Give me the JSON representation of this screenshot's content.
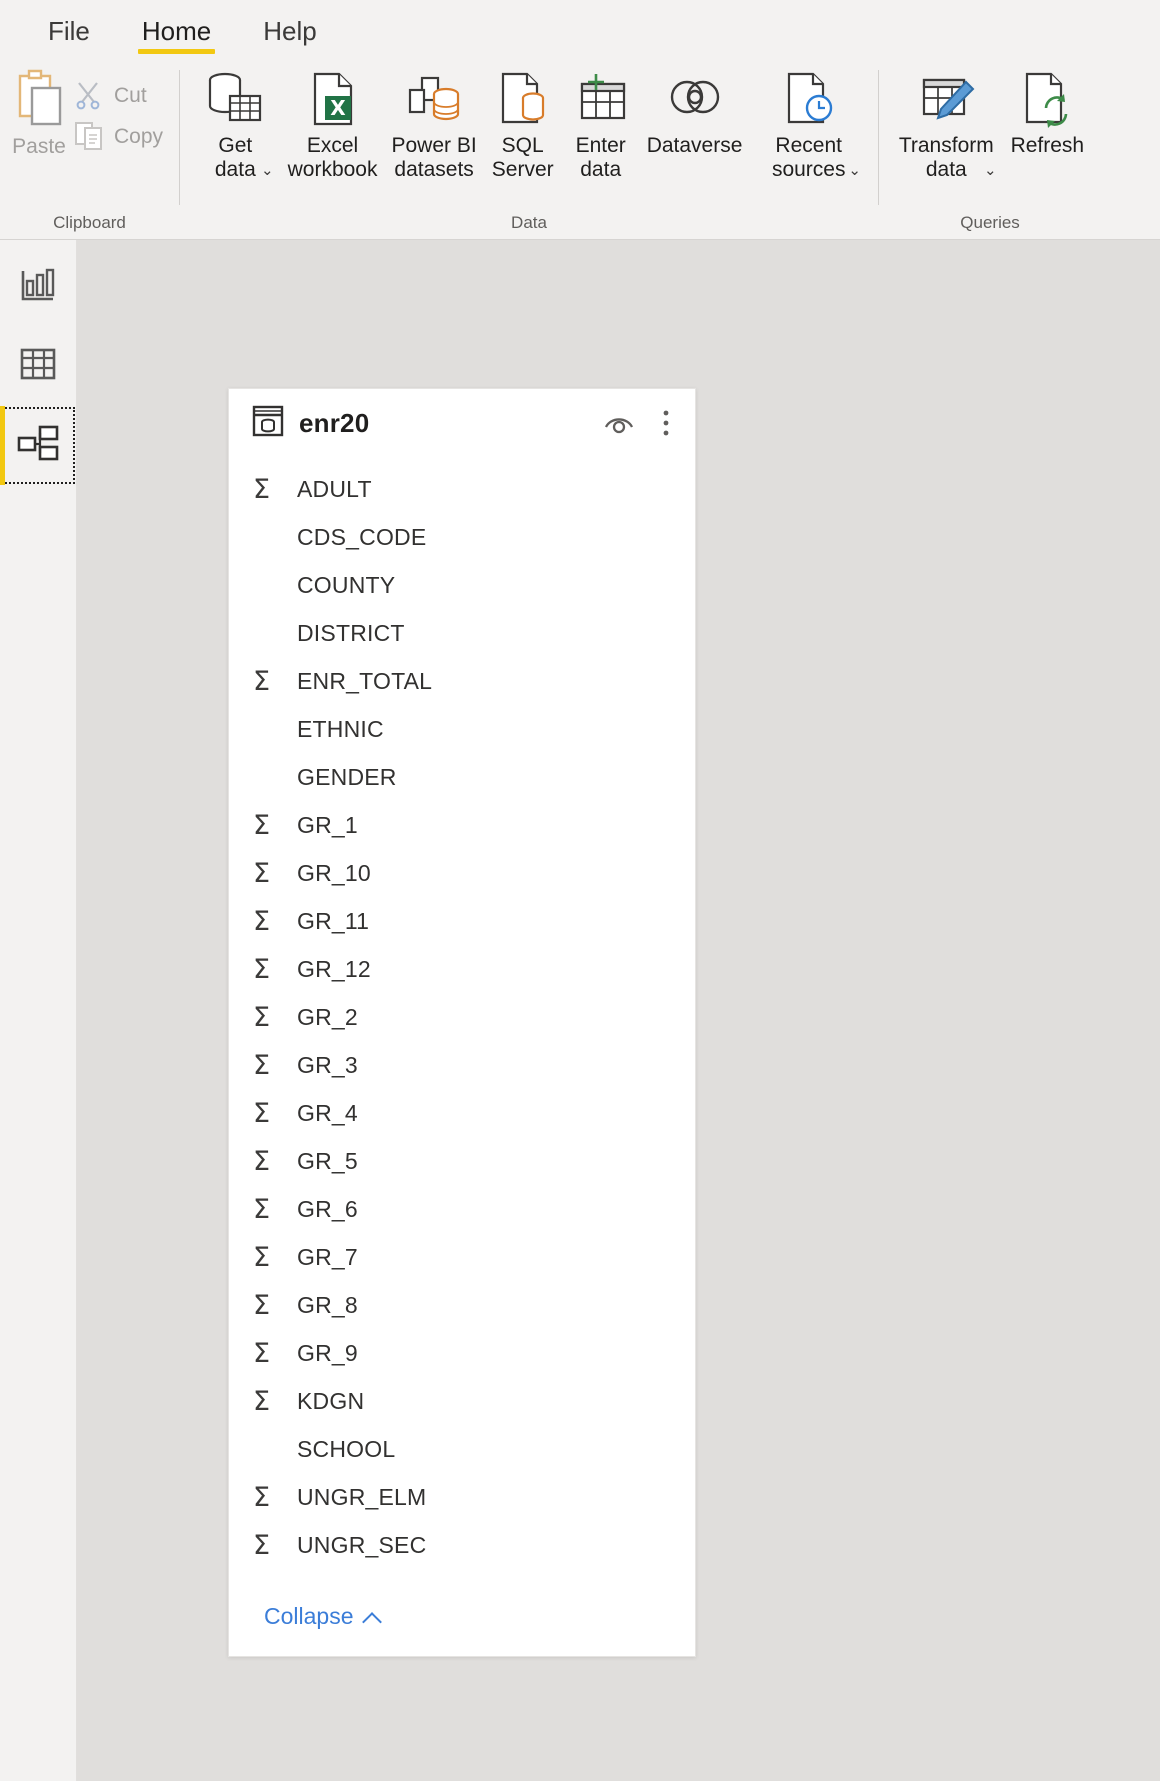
{
  "app": {
    "name": "Power BI Desktop",
    "accent_yellow": "#f2c811",
    "canvas_color": "#e0dedc"
  },
  "ribbon": {
    "tabs": [
      {
        "label": "File",
        "active": false
      },
      {
        "label": "Home",
        "active": true
      },
      {
        "label": "Help",
        "active": false
      }
    ],
    "groups": [
      {
        "name": "Clipboard",
        "label": "Clipboard",
        "buttons": [
          {
            "label": "Paste",
            "icon": "paste-icon",
            "disabled": true
          },
          {
            "label": "Cut",
            "icon": "scissors-icon",
            "disabled": true
          },
          {
            "label": "Copy",
            "icon": "copy-icon",
            "disabled": true
          }
        ]
      },
      {
        "name": "Data",
        "label": "Data",
        "buttons": [
          {
            "label": "Get\ndata",
            "icon": "get-data-icon",
            "has_caret": true
          },
          {
            "label": "Excel\nworkbook",
            "icon": "excel-workbook-icon",
            "has_caret": false
          },
          {
            "label": "Power BI\ndatasets",
            "icon": "powerbi-datasets-icon",
            "has_caret": false
          },
          {
            "label": "SQL\nServer",
            "icon": "sql-server-icon",
            "has_caret": false
          },
          {
            "label": "Enter\ndata",
            "icon": "enter-data-icon",
            "has_caret": false
          },
          {
            "label": "Dataverse",
            "icon": "dataverse-icon",
            "has_caret": false
          },
          {
            "label": "Recent\nsources",
            "icon": "recent-sources-icon",
            "has_caret": true
          }
        ]
      },
      {
        "name": "Queries",
        "label": "Queries",
        "buttons": [
          {
            "label": "Transform\ndata",
            "icon": "transform-data-icon",
            "has_caret": true
          },
          {
            "label": "Refresh",
            "icon": "refresh-icon",
            "has_caret": false
          }
        ]
      }
    ]
  },
  "view_switcher": {
    "items": [
      {
        "name": "report-view",
        "icon": "bar-chart-icon",
        "selected": false
      },
      {
        "name": "data-view",
        "icon": "table-grid-icon",
        "selected": false
      },
      {
        "name": "model-view",
        "icon": "model-relationship-icon",
        "selected": true
      }
    ]
  },
  "table_card": {
    "title": "enr20",
    "table_icon": "table-database-icon",
    "hide_icon": "eye-icon",
    "more_icon": "more-vertical-icon",
    "fields": [
      {
        "name": "ADULT",
        "numeric": true
      },
      {
        "name": "CDS_CODE",
        "numeric": false
      },
      {
        "name": "COUNTY",
        "numeric": false
      },
      {
        "name": "DISTRICT",
        "numeric": false
      },
      {
        "name": "ENR_TOTAL",
        "numeric": true
      },
      {
        "name": "ETHNIC",
        "numeric": false
      },
      {
        "name": "GENDER",
        "numeric": false
      },
      {
        "name": "GR_1",
        "numeric": true
      },
      {
        "name": "GR_10",
        "numeric": true
      },
      {
        "name": "GR_11",
        "numeric": true
      },
      {
        "name": "GR_12",
        "numeric": true
      },
      {
        "name": "GR_2",
        "numeric": true
      },
      {
        "name": "GR_3",
        "numeric": true
      },
      {
        "name": "GR_4",
        "numeric": true
      },
      {
        "name": "GR_5",
        "numeric": true
      },
      {
        "name": "GR_6",
        "numeric": true
      },
      {
        "name": "GR_7",
        "numeric": true
      },
      {
        "name": "GR_8",
        "numeric": true
      },
      {
        "name": "GR_9",
        "numeric": true
      },
      {
        "name": "KDGN",
        "numeric": true
      },
      {
        "name": "SCHOOL",
        "numeric": false
      },
      {
        "name": "UNGR_ELM",
        "numeric": true
      },
      {
        "name": "UNGR_SEC",
        "numeric": true
      }
    ],
    "sigma_symbol": "Σ",
    "collapse_label": "Collapse"
  }
}
